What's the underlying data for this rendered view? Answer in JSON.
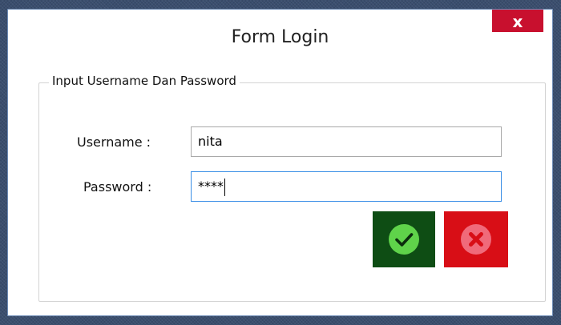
{
  "window": {
    "title": "Form Login",
    "close_label": "x"
  },
  "group": {
    "legend": "Input Username Dan Password"
  },
  "form": {
    "username_label": "Username :",
    "username_value": "nita",
    "password_label": "Password :",
    "password_value": "****"
  },
  "buttons": {
    "ok_icon": "check-icon",
    "cancel_icon": "cancel-x-icon"
  },
  "colors": {
    "ok_bg": "#0e4d14",
    "ok_icon_fill": "#5fd34a",
    "cancel_bg": "#d80e16",
    "cancel_icon_fill": "#f06a7a",
    "close_bg": "#c8102e",
    "focus_border": "#3a8ee6"
  }
}
